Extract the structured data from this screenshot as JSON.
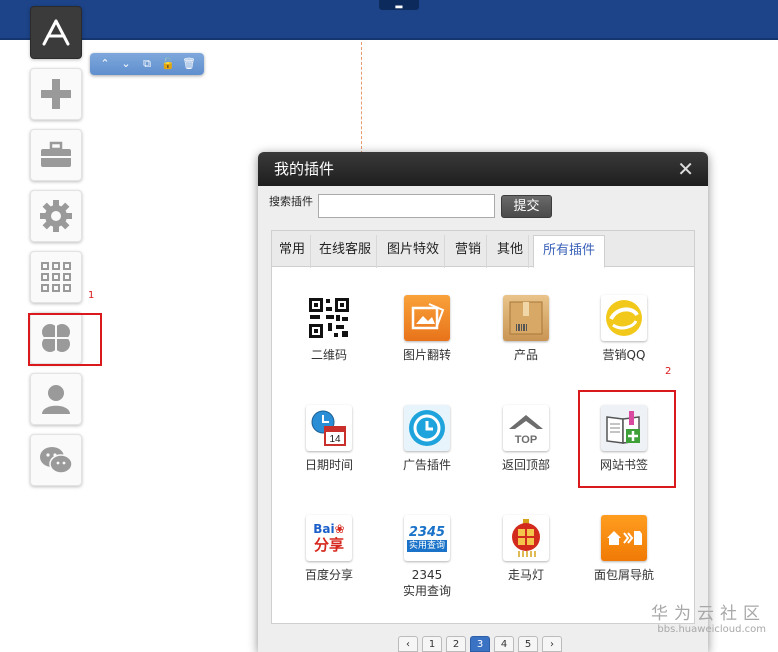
{
  "sidebar": {
    "items": [
      {
        "icon": "app-store-icon"
      },
      {
        "icon": "plus-icon"
      },
      {
        "icon": "toolbox-icon"
      },
      {
        "icon": "gear-icon"
      },
      {
        "icon": "grid-icon"
      },
      {
        "icon": "clover-plugin-icon"
      },
      {
        "icon": "user-icon"
      },
      {
        "icon": "wechat-icon"
      }
    ]
  },
  "mini_toolbar": {
    "icons": [
      "chevron-up-icon",
      "chevron-down-icon",
      "align-icon",
      "lock-icon",
      "trash-icon"
    ],
    "glyphs": [
      "⌃",
      "⌄",
      "⧉",
      "🔓",
      "🗑"
    ]
  },
  "annotations": {
    "first": "1",
    "second": "2",
    "color": "#d9191c"
  },
  "dialog": {
    "title": "我的插件",
    "close_glyph": "✕",
    "search": {
      "label": "搜索插件",
      "value": "",
      "button": "提交"
    },
    "tabs": [
      {
        "label": "常用"
      },
      {
        "label": "在线客服"
      },
      {
        "label": "图片特效"
      },
      {
        "label": "营销"
      },
      {
        "label": "其他"
      },
      {
        "label": "所有插件",
        "active": true
      }
    ],
    "plugins": [
      {
        "label": "二维码",
        "icon": "qr-code-icon"
      },
      {
        "label": "图片翻转",
        "icon": "image-flip-icon"
      },
      {
        "label": "产品",
        "icon": "product-box-icon"
      },
      {
        "label": "营销QQ",
        "icon": "marketing-qq-icon"
      },
      {
        "label": "日期时间",
        "icon": "calendar-clock-icon"
      },
      {
        "label": "广告插件",
        "icon": "ad-plugin-icon"
      },
      {
        "label": "返回顶部",
        "icon": "back-to-top-icon"
      },
      {
        "label": "网站书签",
        "icon": "bookmark-icon"
      },
      {
        "label": "百度分享",
        "icon": "baidu-share-icon",
        "badge": "Bai 分享"
      },
      {
        "label": "2345",
        "label2": "实用查询",
        "icon": "query-2345-icon",
        "badge_top": "2345",
        "badge_bottom": "实用查询"
      },
      {
        "label": "走马灯",
        "icon": "lantern-icon"
      },
      {
        "label": "面包屑导航",
        "icon": "breadcrumb-nav-icon"
      }
    ],
    "pager": [
      "‹",
      "1",
      "2",
      "3",
      "4",
      "5",
      "›"
    ],
    "current_page": "3"
  },
  "watermark": {
    "title": "华为云社区",
    "url": "bbs.huaweicloud.com"
  },
  "colors": {
    "topbar": "#1d4388",
    "active_tab": "#3a62b8",
    "highlight": "#d9191c"
  }
}
